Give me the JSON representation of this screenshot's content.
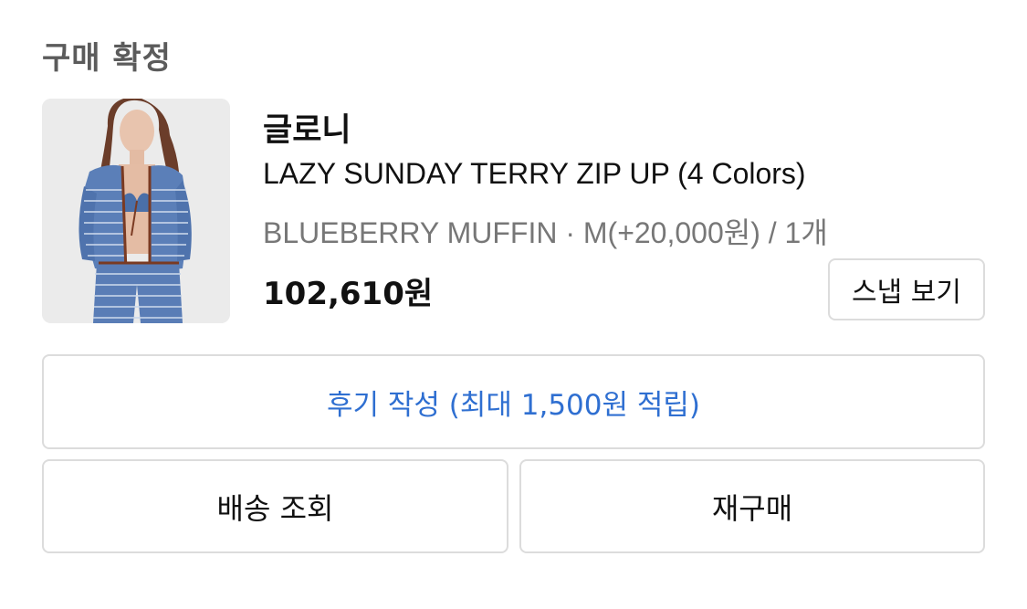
{
  "order": {
    "status_title": "구매 확정"
  },
  "product": {
    "brand": "글로니",
    "name": "LAZY SUNDAY TERRY ZIP UP (4 Colors)",
    "option": "BLUEBERRY MUFFIN · M(+20,000원) / 1개",
    "price": "102,610원",
    "image_icon": "product-photo"
  },
  "actions": {
    "snap_label": "스냅 보기",
    "review_label": "후기 작성 (최대 1,500원 적립)",
    "delivery_label": "배송 조회",
    "rebuy_label": "재구매"
  },
  "colors": {
    "accent_blue": "#2f6fd1",
    "title_gray": "#5b5b5b",
    "option_gray": "#777777",
    "border": "#dcdcdc"
  }
}
